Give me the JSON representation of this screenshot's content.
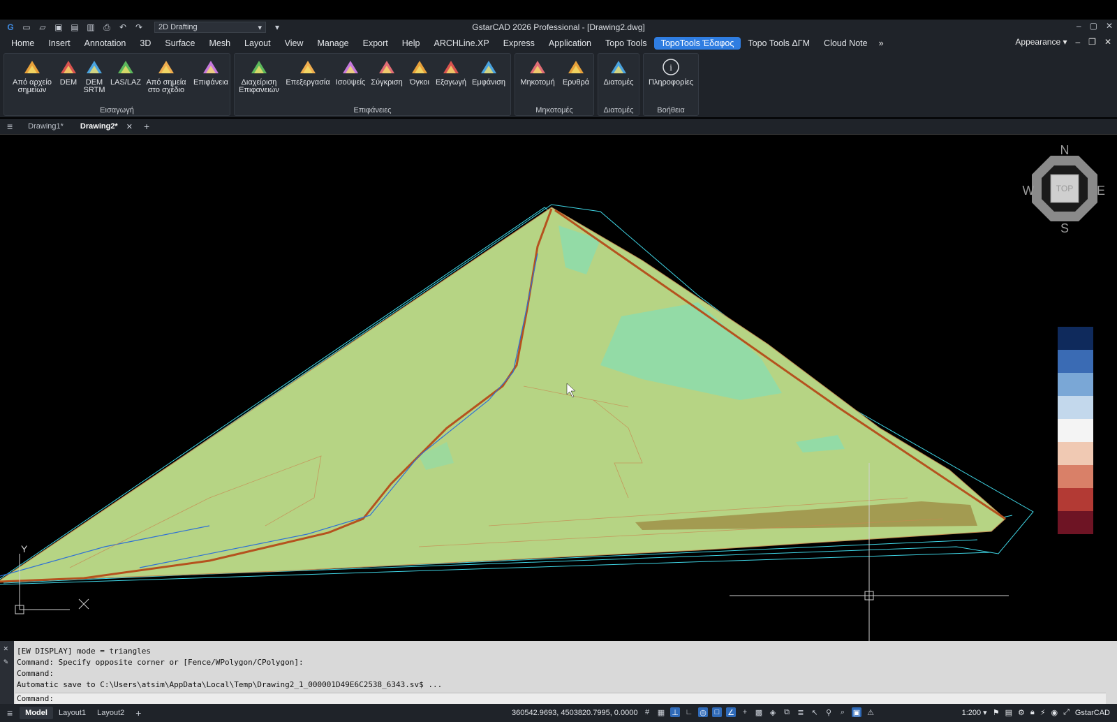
{
  "window": {
    "title": "GstarCAD 2026 Professional - [Drawing2.dwg]",
    "workspace": "2D Drafting"
  },
  "menu": {
    "items": [
      "Home",
      "Insert",
      "Annotation",
      "3D",
      "Surface",
      "Mesh",
      "Layout",
      "View",
      "Manage",
      "Export",
      "Help",
      "ARCHLine.XP",
      "Express",
      "Application",
      "Topo Tools",
      "TopoTools Έδαφος",
      "Topo Tools ΔΓΜ",
      "Cloud Note"
    ],
    "active": "TopoTools Έδαφος",
    "appearance": "Appearance"
  },
  "ribbon": {
    "panels": [
      {
        "title": "Εισαγωγή",
        "buttons": [
          {
            "l1": "Από αρχείο",
            "l2": "σημείων"
          },
          {
            "l1": "DEM",
            "l2": ""
          },
          {
            "l1": "DEM",
            "l2": "SRTM"
          },
          {
            "l1": "LAS/LAZ",
            "l2": ""
          },
          {
            "l1": "Από σημεία",
            "l2": "στο σχέδιο"
          },
          {
            "l1": "Επιφάνεια",
            "l2": ""
          }
        ]
      },
      {
        "title": "Επιφάνειες",
        "buttons": [
          {
            "l1": "Διαχείριση",
            "l2": "Επιφανειών"
          },
          {
            "l1": "Επεξεργασία",
            "l2": ""
          },
          {
            "l1": "Ισοϋψείς",
            "l2": ""
          },
          {
            "l1": "Σύγκριση",
            "l2": ""
          },
          {
            "l1": "Όγκοι",
            "l2": ""
          },
          {
            "l1": "Εξαγωγή",
            "l2": ""
          },
          {
            "l1": "Εμφάνιση",
            "l2": ""
          }
        ]
      },
      {
        "title": "Μηκοτομές",
        "buttons": [
          {
            "l1": "Μηκοτομή",
            "l2": ""
          },
          {
            "l1": "Ερυθρά",
            "l2": ""
          }
        ]
      },
      {
        "title": "Διατομές",
        "buttons": [
          {
            "l1": "Διατομές",
            "l2": ""
          }
        ]
      },
      {
        "title": "Βοήθεια",
        "buttons": [
          {
            "l1": "Πληροφορίες",
            "l2": ""
          }
        ]
      }
    ]
  },
  "doc_tabs": [
    "Drawing1*",
    "Drawing2*"
  ],
  "viewcube": {
    "n": "N",
    "s": "S",
    "e": "E",
    "w": "W",
    "face": "TOP"
  },
  "ucs": {
    "y": "Y",
    "x": "X"
  },
  "command": {
    "lines": [
      "[EW DISPLAY] mode = triangles",
      "Command: Specify opposite corner or [Fence/WPolygon/CPolygon]:",
      "Command:",
      "Automatic save to C:\\Users\\atsim\\AppData\\Local\\Temp\\Drawing2_1_000001D49E6C2538_6343.sv$ ...",
      "Command:"
    ]
  },
  "status": {
    "layout_tabs": [
      "Model",
      "Layout1",
      "Layout2"
    ],
    "coords": "360542.9693, 4503820.7995, 0.0000",
    "scale": "1:200",
    "app": "GstarCAD"
  },
  "legend_colors": [
    "#0f2a5c",
    "#3a6bb4",
    "#7aa7d6",
    "#c3d8ec",
    "#f4f4f4",
    "#f0c9b3",
    "#d98068",
    "#b33a34",
    "#6e1424"
  ]
}
